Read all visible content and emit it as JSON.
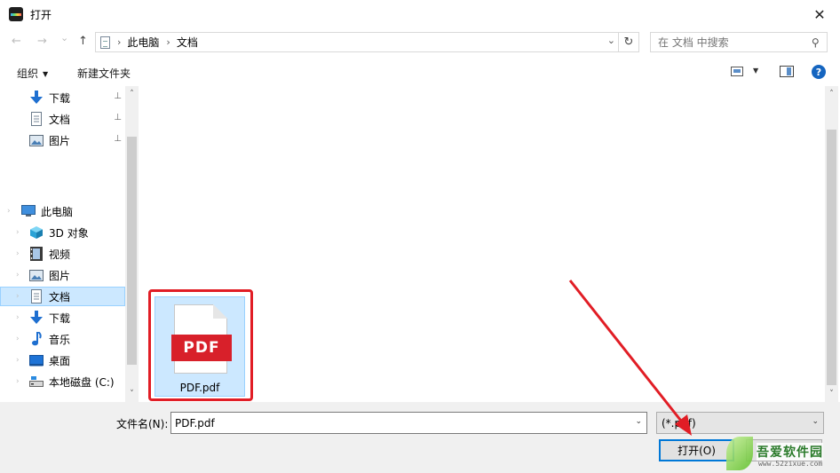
{
  "window": {
    "title": "打开",
    "close_glyph": "✕"
  },
  "address": {
    "back": "←",
    "forward": "→",
    "recent": "⌄",
    "up": "↑",
    "crumbs": [
      "此电脑",
      "文档"
    ],
    "separator": "›",
    "dropdown": "⌄",
    "refresh": "↻",
    "search_placeholder": "在 文档 中搜索",
    "search_glyph": "⚲"
  },
  "toolbar": {
    "organize": "组织",
    "new_folder": "新建文件夹",
    "help": "?"
  },
  "nav": {
    "quick_access": [
      {
        "label": "下载",
        "icon": "download-icon",
        "pinned": true
      },
      {
        "label": "文档",
        "icon": "document-icon",
        "pinned": true
      },
      {
        "label": "图片",
        "icon": "picture-icon",
        "pinned": true
      }
    ],
    "this_pc": {
      "label": "此电脑",
      "icon": "computer-icon"
    },
    "pc_items": [
      {
        "label": "3D 对象",
        "icon": "3d-objects-icon"
      },
      {
        "label": "视频",
        "icon": "video-icon"
      },
      {
        "label": "图片",
        "icon": "picture-icon"
      },
      {
        "label": "文档",
        "icon": "document-icon",
        "selected": true
      },
      {
        "label": "下载",
        "icon": "download-icon"
      },
      {
        "label": "音乐",
        "icon": "music-icon"
      },
      {
        "label": "桌面",
        "icon": "desktop-icon"
      },
      {
        "label": "本地磁盘 (C:)",
        "icon": "drive-icon"
      }
    ],
    "pin_glyph": "📌",
    "expander_glyph": "›",
    "scroll_up": "˄",
    "scroll_down": "˅"
  },
  "files": [
    {
      "name": "PDF.pdf",
      "badge": "PDF",
      "selected": true
    }
  ],
  "bottom": {
    "filename_label": "文件名(N):",
    "filename_value": "PDF.pdf",
    "filetype_value": "(*.pdf)",
    "open_button": "打开(O)",
    "dropdown_glyph": "⌄"
  },
  "watermark": {
    "main": "吾爱软件园",
    "url": "www.52zixue.com"
  },
  "colors": {
    "selection": "#cce8ff",
    "highlight_red": "#e11d25",
    "accent": "#0078d7",
    "pdf_red": "#d8202a"
  }
}
